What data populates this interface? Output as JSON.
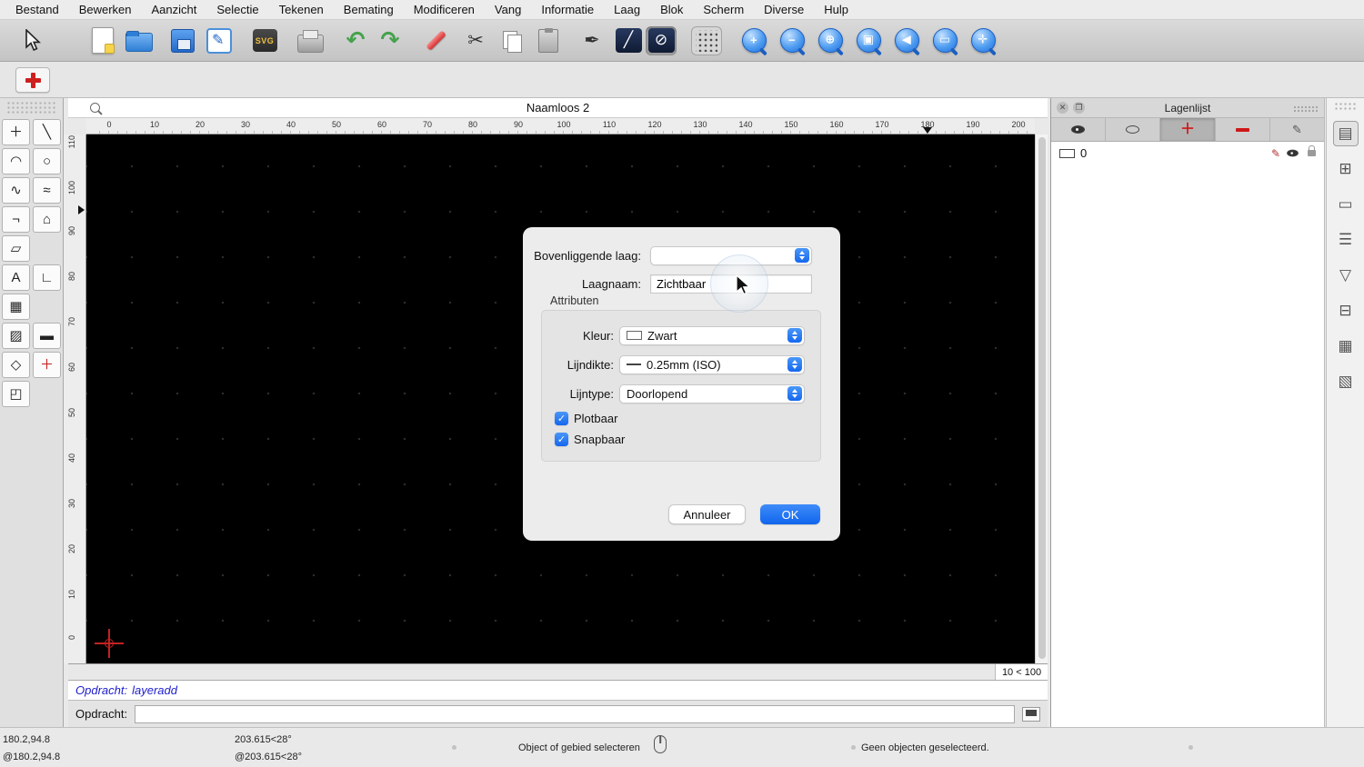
{
  "menubar": {
    "items": [
      "Bestand",
      "Bewerken",
      "Aanzicht",
      "Selectie",
      "Tekenen",
      "Bemating",
      "Modificeren",
      "Vang",
      "Informatie",
      "Laag",
      "Blok",
      "Scherm",
      "Diverse",
      "Hulp"
    ]
  },
  "toolbar": {
    "icons": [
      {
        "name": "cursor-tool-icon",
        "cls": "cursor"
      },
      {
        "name": "new-document-icon",
        "cls": "page",
        "gap": 44
      },
      {
        "name": "open-file-icon",
        "cls": "folder",
        "gap": 6
      },
      {
        "name": "save-icon",
        "cls": "floppy",
        "gap": 14
      },
      {
        "name": "edit-drawing-icon",
        "cls": "editbox",
        "gap": 6
      },
      {
        "name": "svg-export-icon",
        "cls": "svg",
        "label": "SVG",
        "gap": 16
      },
      {
        "name": "print-icon",
        "cls": "printer",
        "gap": 16
      },
      {
        "name": "undo-icon",
        "cls": "green",
        "glyph": "↶",
        "gap": 16
      },
      {
        "name": "redo-icon",
        "cls": "green",
        "glyph": "↷",
        "gap": 4
      },
      {
        "name": "marker-icon",
        "cls": "marker",
        "gap": 16
      },
      {
        "name": "cut-icon",
        "cls": "plain",
        "glyph": "✂",
        "gap": 10
      },
      {
        "name": "copy-icon",
        "cls": "copy",
        "gap": 6
      },
      {
        "name": "paste-icon",
        "cls": "clipboard",
        "gap": 6
      },
      {
        "name": "pen-icon",
        "cls": "plain",
        "glyph": "✒",
        "gap": 14
      },
      {
        "name": "line-style-icon",
        "cls": "navy",
        "glyph": "╱",
        "gap": 6
      },
      {
        "name": "ellipse-mode-icon",
        "cls": "navy",
        "glyph": "⊘",
        "selected": true,
        "gap": 2
      },
      {
        "name": "grid-toggle-icon",
        "cls": "gridic",
        "pressed": true,
        "gap": 16
      },
      {
        "name": "zoom-in-icon",
        "cls": "mag",
        "glyph": "+",
        "gap": 18
      },
      {
        "name": "zoom-out-icon",
        "cls": "mag",
        "glyph": "−",
        "gap": 8
      },
      {
        "name": "zoom-extents-icon",
        "cls": "mag",
        "glyph": "⊕",
        "gap": 8
      },
      {
        "name": "zoom-window-icon",
        "cls": "mag",
        "glyph": "▣",
        "gap": 8
      },
      {
        "name": "zoom-previous-icon",
        "cls": "mag",
        "glyph": "◀",
        "gap": 8
      },
      {
        "name": "zoom-selection-icon",
        "cls": "mag",
        "glyph": "▭",
        "gap": 8
      },
      {
        "name": "pan-icon",
        "cls": "mag",
        "glyph": "✛",
        "gap": 8
      }
    ]
  },
  "palette": {
    "tools": [
      {
        "name": "move-tool",
        "glyph": "＋"
      },
      {
        "name": "line-tool",
        "glyph": "╲"
      },
      {
        "name": "arc-tool",
        "glyph": "◠"
      },
      {
        "name": "ellipse-tool",
        "glyph": "○"
      },
      {
        "name": "spline-tool",
        "glyph": "∿"
      },
      {
        "name": "polyline-tool",
        "glyph": "≈"
      },
      {
        "name": "angle-line-tool",
        "glyph": "¬"
      },
      {
        "name": "polygon-tool",
        "glyph": "⌂"
      },
      {
        "name": "hatch-parallelogram-tool",
        "glyph": "▱"
      },
      null,
      {
        "name": "text-tool",
        "glyph": "A"
      },
      {
        "name": "dimension-tool",
        "glyph": "∟"
      },
      {
        "name": "image-tool",
        "glyph": "▦"
      },
      null,
      {
        "name": "fill-tool",
        "glyph": "▨"
      },
      {
        "name": "measure-tool",
        "glyph": "▬"
      },
      {
        "name": "shape-tool",
        "glyph": "◇"
      },
      {
        "name": "crosshair-tool",
        "glyph": "＋",
        "red": true
      },
      {
        "name": "cube-tool",
        "glyph": "◰"
      },
      null
    ]
  },
  "document": {
    "title": "Naamloos 2"
  },
  "canvas": {
    "zoom_indicator": "10 < 100"
  },
  "rulers": {
    "horizontal_labels": [
      "0",
      "10",
      "20",
      "30",
      "40",
      "50",
      "60",
      "70",
      "80",
      "90",
      "100",
      "110",
      "120",
      "130",
      "140",
      "150",
      "160",
      "170",
      "180",
      "190",
      "200"
    ],
    "vertical_labels": [
      "110",
      "100",
      "90",
      "80",
      "70",
      "60",
      "50",
      "40",
      "30",
      "20",
      "10",
      "0"
    ],
    "marker_value": "180"
  },
  "layers_panel": {
    "title": "Lagenlijst",
    "tabs": [
      {
        "name": "show-layers-tab",
        "kind": "eye-filled"
      },
      {
        "name": "isolate-layers-tab",
        "kind": "eye-outline"
      },
      {
        "name": "add-layer-tab",
        "kind": "plus",
        "selected": true
      },
      {
        "name": "delete-layer-tab",
        "kind": "minus"
      },
      {
        "name": "edit-layer-tab",
        "kind": "pen"
      }
    ],
    "rows": [
      {
        "name": "0"
      }
    ]
  },
  "side_strip": {
    "icons": [
      {
        "name": "layers-palette-icon",
        "glyph": "▤",
        "selected": true
      },
      {
        "name": "blocks-palette-icon",
        "glyph": "⊞"
      },
      {
        "name": "pages-palette-icon",
        "glyph": "▭"
      },
      {
        "name": "list-palette-icon",
        "glyph": "☰"
      },
      {
        "name": "filter-palette-icon",
        "glyph": "▽"
      },
      {
        "name": "references-palette-icon",
        "glyph": "⊟"
      },
      {
        "name": "notes-palette-icon",
        "glyph": "▦"
      },
      {
        "name": "clipboard-palette-icon",
        "glyph": "▧"
      }
    ]
  },
  "dialog": {
    "parent_layer_label": "Bovenliggende laag:",
    "parent_layer_value": "",
    "layer_name_label": "Laagnaam:",
    "layer_name_value": "Zichtbaar",
    "attributes_label": "Attributen",
    "color_label": "Kleur:",
    "color_value": "Zwart",
    "color_swatch_hex": "#000000",
    "lineweight_label": "Lijndikte:",
    "lineweight_value": "0.25mm (ISO)",
    "linetype_label": "Lijntype:",
    "linetype_value": "Doorlopend",
    "plottable_label": "Plotbaar",
    "plottable_checked": true,
    "snappable_label": "Snapbaar",
    "snappable_checked": true,
    "cancel_label": "Annuleer",
    "ok_label": "OK"
  },
  "command": {
    "history_label": "Opdracht:",
    "history_value": "layeradd",
    "prompt_label": "Opdracht:",
    "prompt_value": ""
  },
  "statusbar": {
    "abs_coord": "180.2,94.8",
    "rel_coord": "@180.2,94.8",
    "abs_polar": "203.615<28°",
    "rel_polar": "@203.615<28°",
    "hint": "Object of gebied selecteren",
    "selection_status": "Geen objecten geselecteerd."
  },
  "colors": {
    "accent": "#1567ee",
    "canvas": "#000000",
    "command_text": "#1c1ccd",
    "danger_red": "#ce1f1f"
  }
}
